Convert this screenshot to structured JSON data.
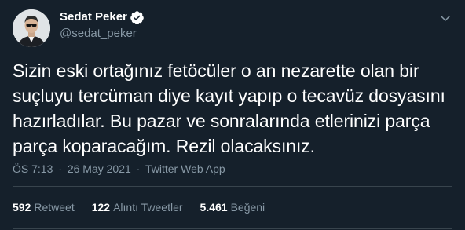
{
  "author": {
    "name": "Sedat Peker",
    "handle": "@sedat_peker",
    "avatar_icon": "profile-photo",
    "verified_icon": "verified-badge-icon"
  },
  "tweet": {
    "text": "Sizin eski ortağınız fetöcüler o an nezarette olan bir suçluyu tercüman diye kayıt yapıp o tecavüz dosyasını hazırladılar. Bu pazar ve sonralarında etlerinizi parça parça koparacağım. Rezil olacaksınız.",
    "time": "ÖS 7:13",
    "date": "26 May 2021",
    "separator": "·",
    "source": "Twitter Web App"
  },
  "stats": {
    "retweets_count": "592",
    "retweets_label": "Retweet",
    "quotes_count": "122",
    "quotes_label": "Alıntı Tweetler",
    "likes_count": "5.461",
    "likes_label": "Beğeni"
  },
  "colors": {
    "background": "#15202b",
    "text": "#ffffff",
    "secondary": "#8899a6",
    "accent": "#1da1f2",
    "divider": "#38444d"
  }
}
